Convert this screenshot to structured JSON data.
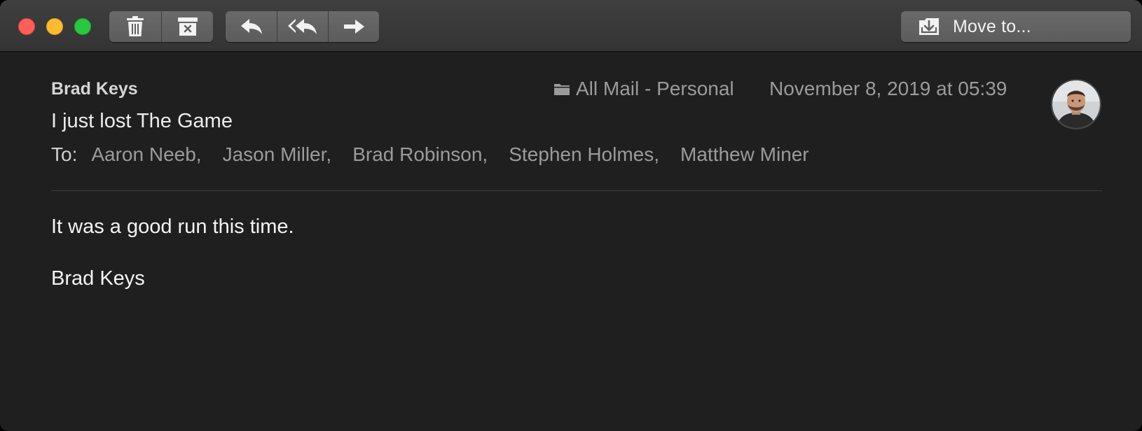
{
  "toolbar": {
    "buttons": {
      "delete_icon": "trash-icon",
      "junk_icon": "junk-box-icon",
      "reply_icon": "reply-icon",
      "reply_all_icon": "reply-all-icon",
      "forward_icon": "forward-icon",
      "move_icon": "move-to-tray-icon"
    },
    "move_label": "Move to..."
  },
  "message": {
    "sender": "Brad Keys",
    "mailbox": "All Mail - Personal",
    "date": "November 8, 2019 at 05:39",
    "subject": "I just lost The Game",
    "to_label": "To:",
    "recipients": [
      "Aaron Neeb,",
      "Jason Miller,",
      "Brad Robinson,",
      "Stephen Holmes,",
      "Matthew Miner"
    ],
    "body": [
      "It was a good run this time.",
      "Brad Keys"
    ]
  },
  "colors": {
    "window_bg": "#1f1f1f",
    "titlebar": "#393939",
    "close": "#fe5f57",
    "minimize": "#febb2e",
    "maximize": "#29c840"
  }
}
